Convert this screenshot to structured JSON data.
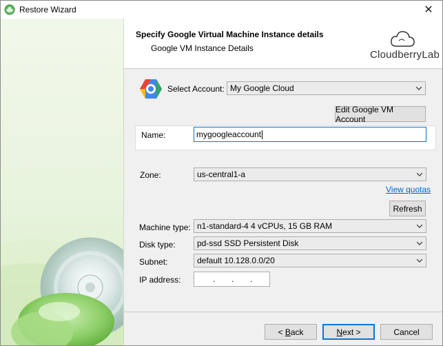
{
  "window": {
    "title": "Restore Wizard",
    "close_glyph": "✕"
  },
  "header": {
    "title": "Specify Google Virtual Machine Instance details",
    "subtitle": "Google VM Instance Details",
    "logo_text": "CloudberryLab"
  },
  "form": {
    "account_label": "Select Account:",
    "account_value": "My Google Cloud",
    "edit_account_button": "Edit Google VM Account",
    "name_label": "Name:",
    "name_value": "mygoogleaccount",
    "zone_label": "Zone:",
    "zone_value": "us-central1-a",
    "view_quotas_link": "View quotas",
    "refresh_button": "Refresh",
    "machine_type_label": "Machine type:",
    "machine_type_value": "n1-standard-4 4 vCPUs, 15 GB RAM",
    "disk_type_label": "Disk type:",
    "disk_type_value": "pd-ssd SSD Persistent Disk",
    "subnet_label": "Subnet:",
    "subnet_value": "default 10.128.0.0/20",
    "ip_label": "IP address:",
    "ip_dots": [
      ".",
      ".",
      "."
    ]
  },
  "footer": {
    "back_mnemonic": "B",
    "back_rest": "ack",
    "back_prefix": "< ",
    "next_mnemonic": "N",
    "next_rest": "ext >",
    "cancel": "Cancel"
  },
  "colors": {
    "accent": "#0078d7",
    "link": "#0066cc",
    "panel_bg": "#f0f0f0"
  },
  "icons": {
    "app": "cloud-disk-icon",
    "account": "google-cloud-hexagon-icon",
    "dropdown": "chevron-down-icon",
    "close": "close-icon",
    "logo": "cloud-logo-icon"
  }
}
